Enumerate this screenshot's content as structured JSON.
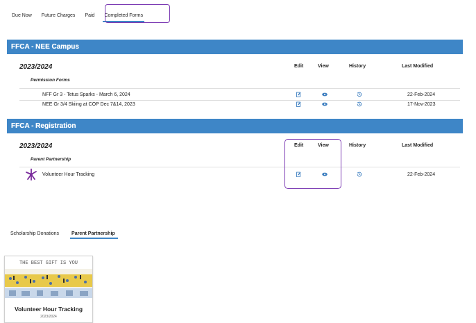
{
  "top_tabs": [
    {
      "label": "Due Now"
    },
    {
      "label": "Future Charges"
    },
    {
      "label": "Paid"
    },
    {
      "label": "Completed Forms"
    }
  ],
  "sections": [
    {
      "title": "FFCA - NEE Campus",
      "year": "2023/2024",
      "columns": {
        "edit": "Edit",
        "view": "View",
        "history": "History",
        "last_modified": "Last Modified"
      },
      "category": "Permission Forms",
      "rows": [
        {
          "name": "NFF Gr 3 - Tetus Sparks - March 6, 2024",
          "date": "22-Feb-2024"
        },
        {
          "name": "NEE Gr 3/4 Skiing at COP Dec 7&14, 2023",
          "date": "17-Nov-2023"
        }
      ]
    },
    {
      "title": "FFCA - Registration",
      "year": "2023/2024",
      "columns": {
        "edit": "Edit",
        "view": "View",
        "history": "History",
        "last_modified": "Last Modified"
      },
      "category": "Parent Partnership",
      "rows": [
        {
          "name": "Volunteer Hour Tracking",
          "date": "22-Feb-2024"
        }
      ]
    }
  ],
  "bottom_tabs": [
    {
      "label": "Scholarship Donations"
    },
    {
      "label": "Parent Partnership"
    }
  ],
  "card": {
    "title": "Volunteer Hour Tracking",
    "subtitle": "2023/2024",
    "banner_text": "THE BEST GIFT IS YOU"
  },
  "colors": {
    "header_blue": "#3e86c7",
    "annotation_purple": "#7b3ab3",
    "icon_blue": "#3e7fc0",
    "logo_purple": "#7a2b9c"
  }
}
